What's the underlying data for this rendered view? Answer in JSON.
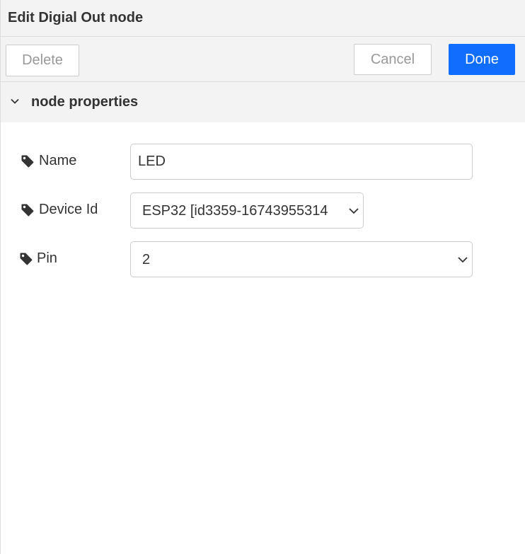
{
  "tray": {
    "title": "Edit Digial Out node"
  },
  "toolbar": {
    "delete_label": "Delete",
    "cancel_label": "Cancel",
    "done_label": "Done"
  },
  "section": {
    "title": "node properties",
    "icon": "chevron-down-icon"
  },
  "form": {
    "name": {
      "label": "Name",
      "icon": "tag-icon",
      "value": "LED"
    },
    "device_id": {
      "label": "Device Id",
      "icon": "tag-icon",
      "selected": "ESP32 [id3359-16743955314"
    },
    "pin": {
      "label": "Pin",
      "icon": "tag-icon",
      "selected": "2"
    }
  },
  "colors": {
    "primary": "#0f6efd",
    "header_bg": "#f3f3f3",
    "text": "#333333",
    "muted_text": "#999999",
    "border": "#cccccc"
  }
}
